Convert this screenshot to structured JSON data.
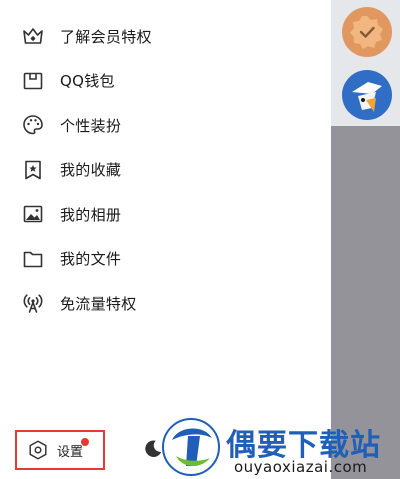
{
  "menu": {
    "items": [
      {
        "label": "了解会员特权",
        "icon": "crown-icon"
      },
      {
        "label": "QQ钱包",
        "icon": "wallet-icon"
      },
      {
        "label": "个性装扮",
        "icon": "palette-icon"
      },
      {
        "label": "我的收藏",
        "icon": "bookmark-star-icon"
      },
      {
        "label": "我的相册",
        "icon": "photo-album-icon"
      },
      {
        "label": "我的文件",
        "icon": "folder-icon"
      },
      {
        "label": "免流量特权",
        "icon": "signal-tower-icon"
      }
    ]
  },
  "footer": {
    "settings_label": "设置",
    "night_label": "夜间"
  },
  "watermark": {
    "title": "偶要下载站",
    "subtitle": "ouyaoxiazai.com"
  },
  "colors": {
    "highlight_border": "#e53935",
    "notification_dot": "#e53935",
    "side_panel": "#939399",
    "watermark_blue": "#1f5fb8"
  }
}
